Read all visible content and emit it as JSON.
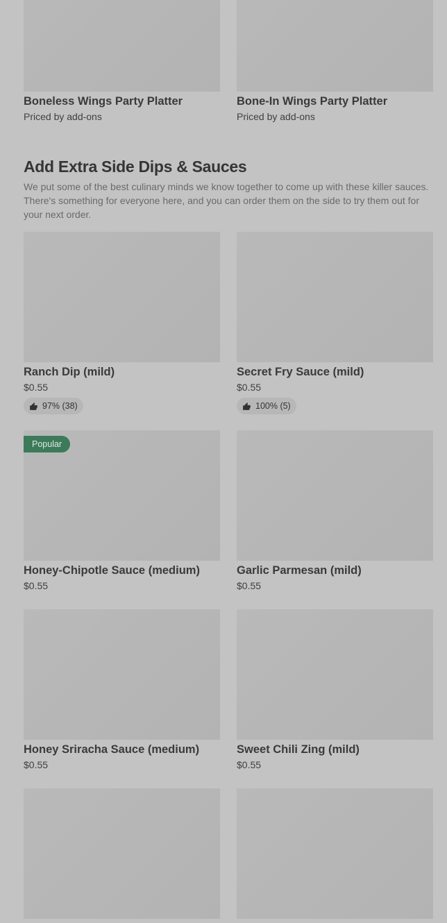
{
  "top_items": [
    {
      "title": "Boneless Wings Party Platter",
      "price": "Priced by add-ons"
    },
    {
      "title": "Bone-In Wings Party Platter",
      "price": "Priced by add-ons"
    }
  ],
  "section": {
    "title": "Add Extra Side Dips & Sauces",
    "description": "We put some of the best culinary minds we know together to come up with these killer sauces. There's something for everyone here, and you can order them on the side to try them out for your next order."
  },
  "items": [
    {
      "title": "Ranch Dip (mild)",
      "price": "$0.55",
      "rating": "97% (38)"
    },
    {
      "title": "Secret Fry Sauce (mild)",
      "price": "$0.55",
      "rating": "100% (5)"
    },
    {
      "title": "Honey-Chipotle Sauce (medium)",
      "price": "$0.55",
      "badge": "Popular"
    },
    {
      "title": "Garlic Parmesan (mild)",
      "price": "$0.55"
    },
    {
      "title": "Honey Sriracha Sauce (medium)",
      "price": "$0.55"
    },
    {
      "title": "Sweet Chili Zing (mild)",
      "price": "$0.55"
    }
  ],
  "icons": {
    "rating": "thumbs-up-icon"
  },
  "colors": {
    "badge": "#3c7a5a",
    "background": "#c3c3c3"
  }
}
